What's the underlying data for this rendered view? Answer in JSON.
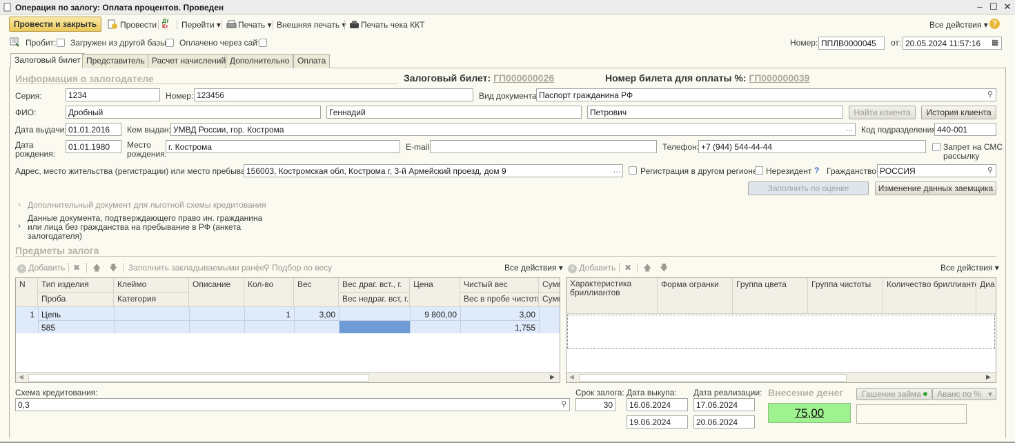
{
  "window": {
    "title": "Операция по залогу: Оплата процентов. Проведен"
  },
  "toolbar": {
    "post_close": "Провести и закрыть",
    "post": "Провести",
    "goto": "Перейти",
    "print": "Печать",
    "ext_print": "Внешняя печать",
    "print_check": "Печать чека ККТ",
    "all_actions": "Все действия"
  },
  "flags": {
    "probit": "Пробит:",
    "loaded": "Загружен из другой базы:",
    "paid_site": "Оплачено через сайт:"
  },
  "doc": {
    "number_label": "Номер:",
    "number": "ППЛВ0000045",
    "date_label": "от:",
    "date": "20.05.2024 11:57:16"
  },
  "tabs": [
    "Залоговый билет",
    "Представитель",
    "Расчет начислений",
    "Дополнительно",
    "Оплата"
  ],
  "header": {
    "section": "Информация о залогодателе",
    "ticket_label": "Залоговый билет:",
    "ticket": "ГП000000026",
    "pay_ticket_label": "Номер билета для оплаты %:",
    "pay_ticket": "ГП000000039"
  },
  "person": {
    "series_label": "Серия:",
    "series": "1234",
    "number_label": "Номер:",
    "number": "123456",
    "doc_type_label": "Вид документа:",
    "doc_type": "Паспорт гражданина РФ",
    "fio_label": "ФИО:",
    "last": "Дробный",
    "first": "Геннадий",
    "middle": "Петрович",
    "find_client": "Найти клиента",
    "client_history": "История клиента",
    "issue_date_label": "Дата выдачи:",
    "issue_date": "01.01.2016",
    "issued_by_label": "Кем выдан:",
    "issued_by": "УМВД России, гор. Кострома",
    "dept_code_label": "Код подразделения:",
    "dept_code": "440-001",
    "birth_date_label_1": "Дата",
    "birth_date_label_2": "рождения:",
    "birth_date": "01.01.1980",
    "birth_place_label_1": "Место",
    "birth_place_label_2": "рождения:",
    "birth_place": "г. Кострома",
    "email_label": "E-mail:",
    "email": "",
    "phone_label": "Телефон:",
    "phone": "+7 (944) 544-44-44",
    "sms_label_1": "Запрет на СМС",
    "sms_label_2": "рассылку",
    "address_label": "Адрес, место жительства (регистрации) или место пребывания:",
    "address": "156003, Костромская обл, Кострома г, 3-й Армейский проезд, дом 9",
    "other_region": "Регистрация в другом регионе",
    "nonresident": "Нерезидент",
    "help": "?",
    "citizenship_label": "Гражданство:",
    "citizenship": "РОССИЯ",
    "fill_eval": "Заполнить по оценке",
    "change_borrower": "Изменение данных заемщика"
  },
  "extra": {
    "doc_benefit": "Дополнительный документ для льготной схемы кредитования",
    "foreign_1": "Данные документа, подтверждающего право ин. гражданина",
    "foreign_2": "или лица без гражданства на пребывание в РФ (анкета",
    "foreign_3": "залогодателя)"
  },
  "items": {
    "section": "Предметы залога",
    "tools": {
      "add": "Добавить",
      "fill_prev": "Заполнить закладываемыми ранее",
      "weight_pick": "Подбор по весу",
      "all_actions": "Все действия"
    },
    "cols": {
      "n": "N",
      "type": "Тип изделия",
      "probe": "Проба",
      "stamp": "Клеймо",
      "category": "Категория",
      "descr": "Описание",
      "qty": "Кол-во",
      "weight": "Вес",
      "precious": "Вес драг. вст., г.",
      "nonprecious": "Вес недраг. вст, г.",
      "price": "Цена",
      "net": "Чистый вес",
      "net_probe": "Вес в пробе чистоты",
      "sum": "Сумм",
      "sum2": "Сумм"
    },
    "rows": [
      {
        "n": "1",
        "type": "Цепь",
        "probe": "585",
        "qty": "1",
        "weight": "3,00",
        "price": "9 800,00",
        "net": "3,00",
        "net_probe": "1,755"
      }
    ]
  },
  "diamonds": {
    "tools": {
      "add": "Добавить",
      "all_actions": "Все действия"
    },
    "cols": [
      "Характеристика бриллиантов",
      "Форма огранки",
      "Группа цвета",
      "Группа чистоты",
      "Количество бриллиантов",
      "Диа"
    ]
  },
  "bottom": {
    "scheme_label": "Схема кредитования:",
    "scheme": "0,3",
    "term_label": "Срок залога:",
    "term": "30",
    "buyout_label": "Дата выкупа:",
    "buyout_1": "16.06.2024",
    "buyout_2": "19.06.2024",
    "sale_label": "Дата реализации:",
    "sale_1": "17.06.2024",
    "sale_2": "20.06.2024",
    "deposit_label": "Внесение денег",
    "amount": "75,00",
    "repay": "Гашение займа",
    "advance": "Аванс по %"
  }
}
